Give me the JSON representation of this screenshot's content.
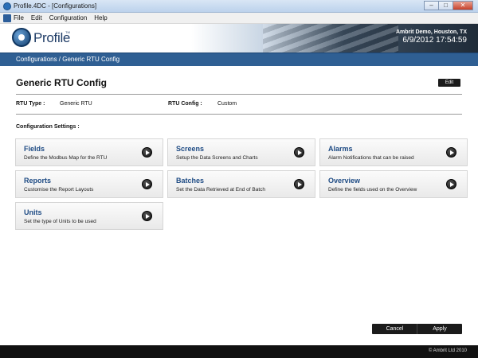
{
  "window": {
    "title": "Profile.4DC - [Configurations]",
    "minimize": "–",
    "maximize": "□",
    "close": "✕"
  },
  "menu": [
    "File",
    "Edit",
    "Configuration",
    "Help"
  ],
  "header": {
    "logo_text": "Profile",
    "logo_tm": "TM",
    "site": "Ambrit Demo, Houston, TX",
    "datetime": "6/9/2012   17:54:59"
  },
  "breadcrumb": "Configurations / Generic RTU Config",
  "page": {
    "title": "Generic RTU Config",
    "edit_label": "Edit",
    "rtu_type_label": "RTU Type :",
    "rtu_type_value": "Generic RTU",
    "rtu_config_label": "RTU Config :",
    "rtu_config_value": "Custom",
    "settings_heading": "Configuration Settings :"
  },
  "tiles": [
    {
      "title": "Fields",
      "desc": "Define the Modbus Map for the RTU"
    },
    {
      "title": "Screens",
      "desc": "Setup the Data Screens and Charts"
    },
    {
      "title": "Alarms",
      "desc": "Alarm Notifications that can be raised"
    },
    {
      "title": "Reports",
      "desc": "Customise the Report Layouts"
    },
    {
      "title": "Batches",
      "desc": "Set the Data Retrieved at End of Batch"
    },
    {
      "title": "Overview",
      "desc": "Define the fields used on the Overview"
    },
    {
      "title": "Units",
      "desc": "Set the type of Units to be used"
    }
  ],
  "actions": {
    "cancel": "Cancel",
    "apply": "Apply"
  },
  "footer": "© Ambrit Ltd 2010",
  "colors": {
    "accent_bar": "#2f5f93",
    "tile_title": "#1e4b84",
    "dark_button": "#1b1b1b"
  },
  "icons": {
    "app": "profile-app-icon",
    "menu": "document-menu-icon",
    "tile_action": "play-arrow-icon"
  }
}
